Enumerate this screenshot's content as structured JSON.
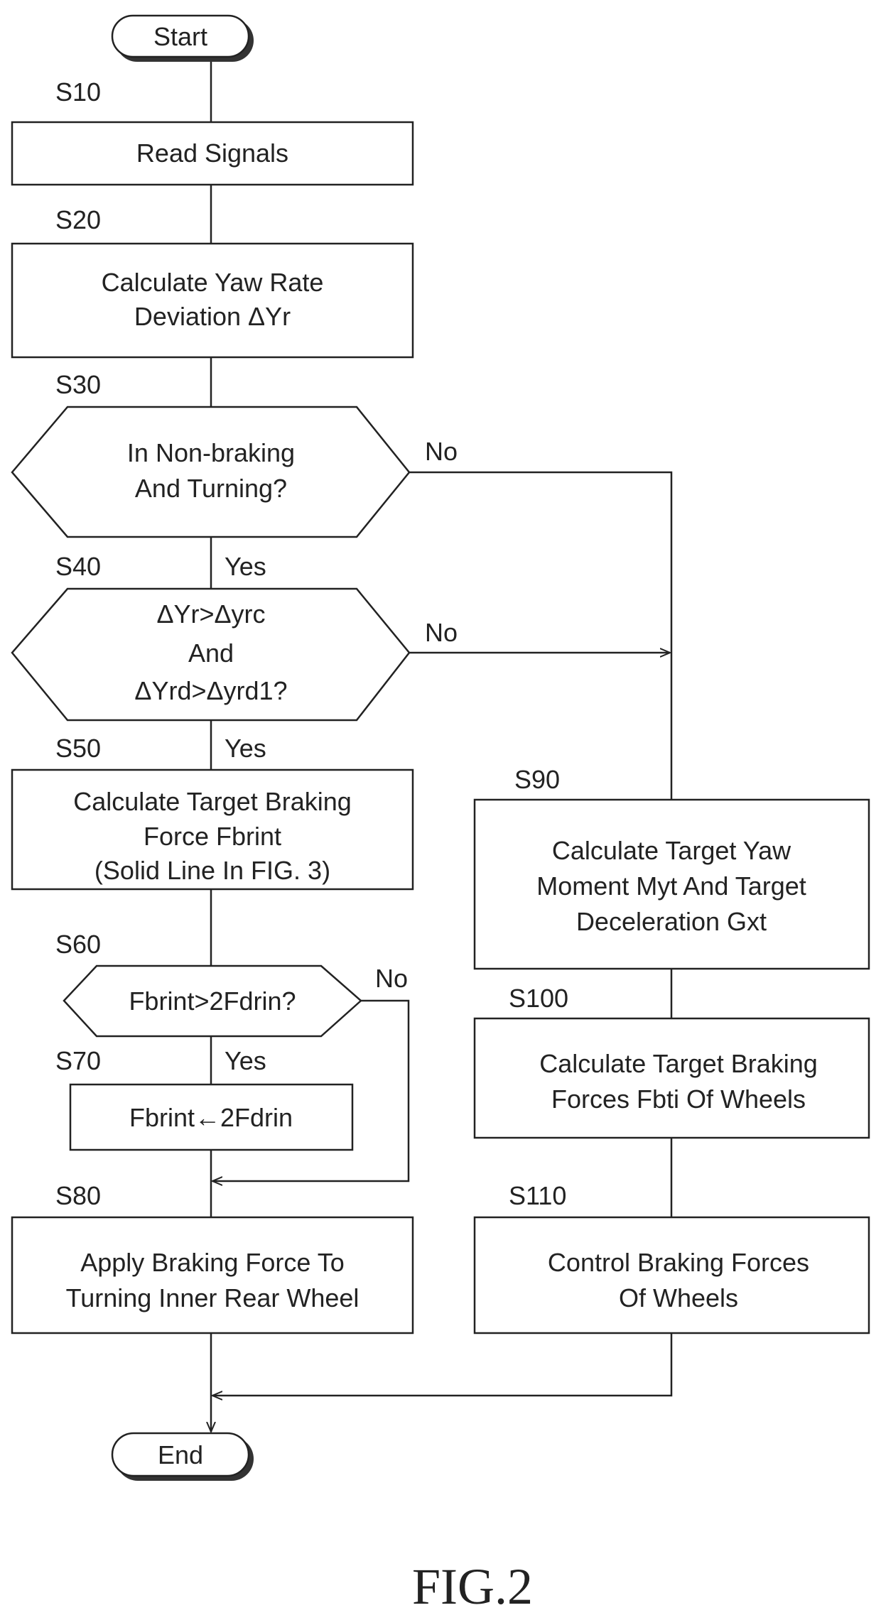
{
  "figure_label": "FIG.2",
  "terminals": {
    "start": "Start",
    "end": "End"
  },
  "steps": {
    "S10": {
      "id": "S10",
      "lines": [
        "Read Signals"
      ]
    },
    "S20": {
      "id": "S20",
      "lines": [
        "Calculate Yaw Rate",
        "Deviation ΔYr"
      ]
    },
    "S30": {
      "id": "S30",
      "lines": [
        "In Non-braking",
        "And Turning?"
      ]
    },
    "S40": {
      "id": "S40",
      "lines": [
        "ΔYr>Δyrc",
        "And",
        "ΔYrd>Δyrd1?"
      ]
    },
    "S50": {
      "id": "S50",
      "lines": [
        "Calculate Target Braking",
        "Force Fbrint",
        "(Solid Line In FIG. 3)"
      ]
    },
    "S60": {
      "id": "S60",
      "lines": [
        "Fbrint>2Fdrin?"
      ]
    },
    "S70": {
      "id": "S70",
      "lines": [
        "Fbrint←2Fdrin"
      ]
    },
    "S80": {
      "id": "S80",
      "lines": [
        "Apply Braking Force To",
        "Turning Inner Rear Wheel"
      ]
    },
    "S90": {
      "id": "S90",
      "lines": [
        "Calculate Target Yaw",
        "Moment Myt And Target",
        "Deceleration Gxt"
      ]
    },
    "S100": {
      "id": "S100",
      "lines": [
        "Calculate Target Braking",
        "Forces Fbti Of  Wheels"
      ]
    },
    "S110": {
      "id": "S110",
      "lines": [
        "Control Braking Forces",
        "Of  Wheels"
      ]
    }
  },
  "branch_labels": {
    "S30_yes": "Yes",
    "S30_no": "No",
    "S40_yes": "Yes",
    "S40_no": "No",
    "S60_yes": "Yes",
    "S60_no": "No"
  }
}
